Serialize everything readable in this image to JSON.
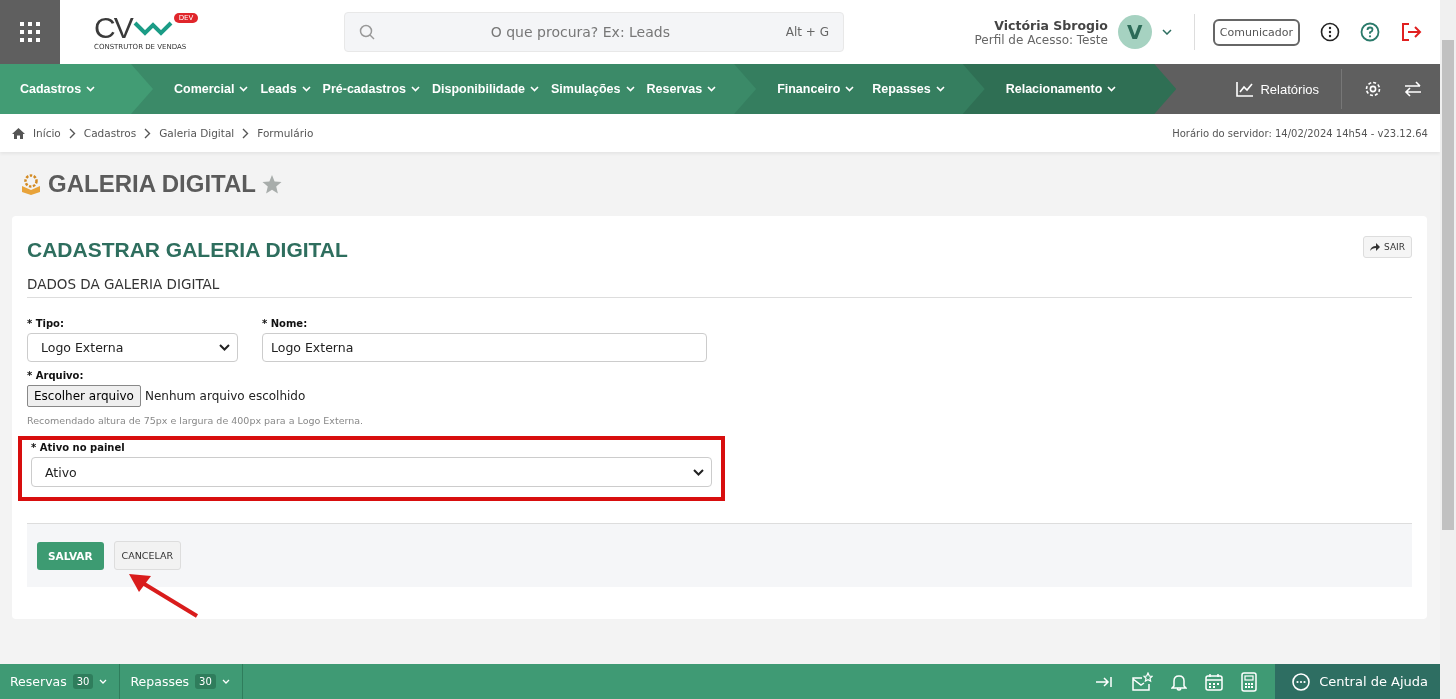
{
  "header": {
    "logo": {
      "letters": "CV",
      "badge": "DEV",
      "tagline": "CONSTRUTOR DE VENDAS"
    },
    "search": {
      "placeholder": "O que procura? Ex: Leads",
      "shortcut": "Alt + G"
    },
    "user": {
      "name": "Victória Sbrogio",
      "profile": "Perfil de Acesso: Teste",
      "initial": "V"
    },
    "communicator": "Comunicador"
  },
  "nav": {
    "groups": [
      {
        "color": "#429c74",
        "items": [
          "Cadastros"
        ]
      },
      {
        "color": "#3b8a68",
        "items": [
          "Comercial",
          "Leads",
          "Pré-cadastros",
          "Disponibilidade",
          "Simulações",
          "Reservas"
        ]
      },
      {
        "color": "#357e5f",
        "items": [
          "Financeiro",
          "Repasses"
        ]
      },
      {
        "color": "#2f6f54",
        "items": [
          "Relacionamento"
        ]
      }
    ],
    "reports": "Relatórios"
  },
  "breadcrumb": {
    "items": [
      "Início",
      "Cadastros",
      "Galeria Digital",
      "Formulário"
    ],
    "server_info": "Horário do servidor: 14/02/2024 14h54 - v23.12.64"
  },
  "page_title": "GALERIA DIGITAL",
  "card": {
    "title": "CADASTRAR GALERIA DIGITAL",
    "exit": "SAIR",
    "section": "DADOS DA GALERIA DIGITAL",
    "tipo": {
      "label": "* Tipo:",
      "value": "Logo Externa"
    },
    "nome": {
      "label": "* Nome:",
      "value": "Logo Externa"
    },
    "arquivo": {
      "label": "* Arquivo:",
      "button": "Escolher arquivo",
      "status": "Nenhum arquivo escolhido",
      "hint": "Recomendado altura de 75px e largura de 400px para a Logo Externa."
    },
    "ativo": {
      "label": "* Ativo no painel",
      "value": "Ativo",
      "highlighted": true
    },
    "buttons": [
      "SALVAR",
      "CANCELAR"
    ]
  },
  "footer": {
    "tabs": [
      {
        "label": "Reservas",
        "count": "30"
      },
      {
        "label": "Repasses",
        "count": "30"
      }
    ],
    "help": "Central de Ajuda"
  }
}
